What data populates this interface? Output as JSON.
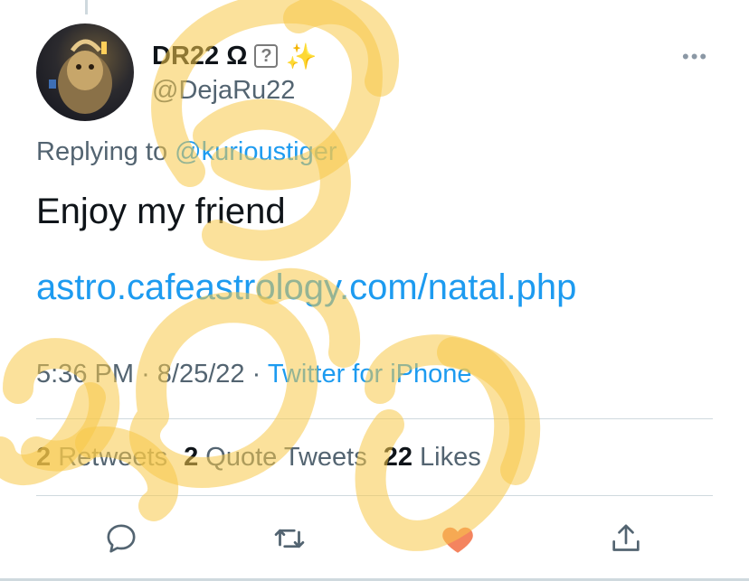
{
  "user": {
    "display_name": "DR22 Ω",
    "badge_glyph": "?",
    "sparkle_glyph": "✨",
    "handle": "@DejaRu22"
  },
  "more_glyph": "•••",
  "reply": {
    "prefix": "Replying to ",
    "mention": "@kurioustiger"
  },
  "tweet": {
    "text": "Enjoy my friend",
    "link": "astro.cafeastrology.com/natal.php"
  },
  "meta": {
    "time": "5:36 PM",
    "date": "8/25/22",
    "separator": "·",
    "source": "Twitter for iPhone"
  },
  "stats": {
    "retweets_count": "2",
    "retweets_label": "Retweets",
    "quotes_count": "2",
    "quotes_label": "Quote Tweets",
    "likes_count": "22",
    "likes_label": "Likes"
  },
  "actions": {
    "reply_icon": "speech-bubble",
    "retweet_icon": "retweet-arrows",
    "like_icon": "heart",
    "share_icon": "share-upload",
    "like_color": "#f4845f"
  },
  "colors": {
    "accent": "#1d9bf0",
    "secondary_text": "#536471",
    "scribble": "#f7c948"
  }
}
